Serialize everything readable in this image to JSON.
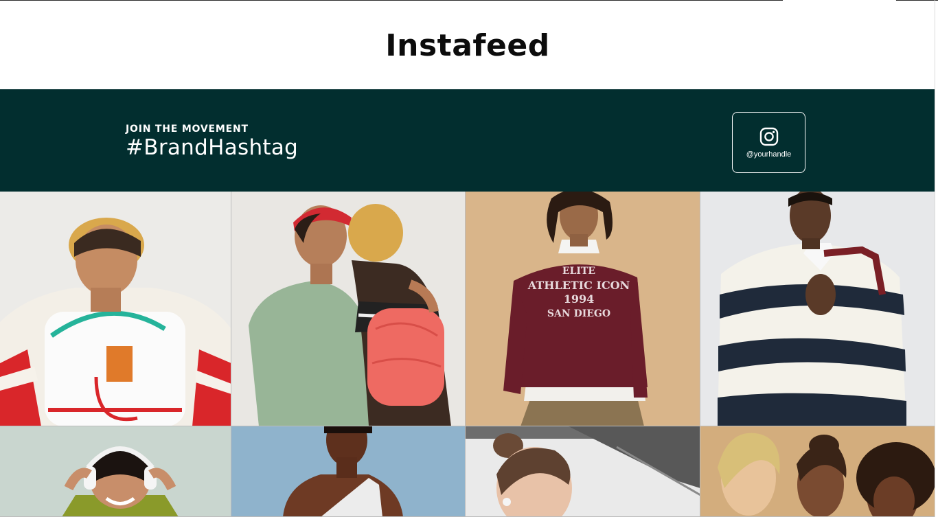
{
  "header": {
    "title": "Instafeed"
  },
  "banner": {
    "kicker": "JOIN THE MOVEMENT",
    "hashtag": "#BrandHashtag",
    "handle": "@yourhandle",
    "icon": "instagram-icon",
    "background": "#022e2f"
  },
  "feed": {
    "posts": [
      {
        "name": "boy-white-backpack",
        "bg": "#ecebe8"
      },
      {
        "name": "kids-red-backpack",
        "bg": "#e9e7e3"
      },
      {
        "name": "woman-maroon-sweatshirt",
        "bg": "#d9b58a"
      },
      {
        "name": "man-striped-rugby",
        "bg": "#e7e8ea"
      },
      {
        "name": "woman-headphones",
        "bg": "#c9d6cf"
      },
      {
        "name": "woman-one-shoulder",
        "bg": "#8fb3cc"
      },
      {
        "name": "woman-earbuds-kitchen",
        "bg": "#eaeaea"
      },
      {
        "name": "three-women-group",
        "bg": "#d3ad7d"
      }
    ]
  }
}
